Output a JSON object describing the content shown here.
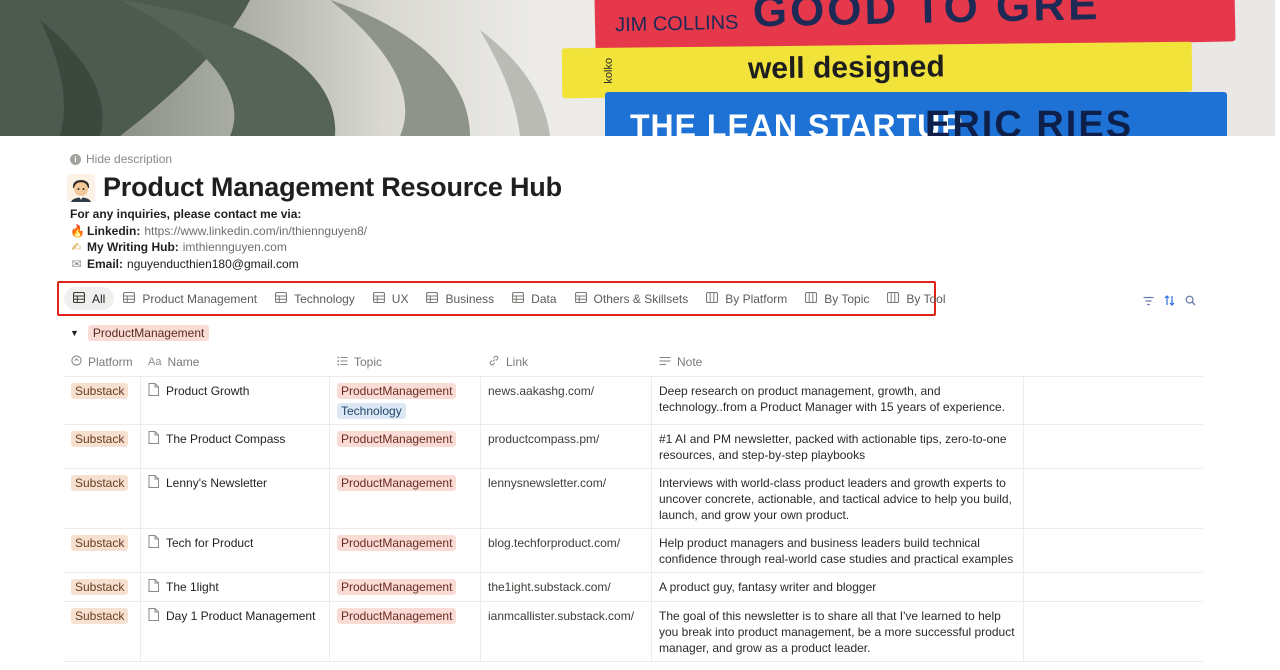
{
  "cover": {
    "books": [
      {
        "author": "JIM COLLINS",
        "title": "GOOD TO GRE",
        "color": "#e8384a"
      },
      {
        "publisher": "kolko",
        "title": "well designed",
        "color": "#f2e23a"
      },
      {
        "title": "THE LEAN STARTUP",
        "author": "ERIC RIES",
        "color": "#1f73d6"
      }
    ]
  },
  "header": {
    "hide_description": "Hide description",
    "title": "Product Management Resource Hub"
  },
  "description": {
    "intro": "For any inquiries, please contact me via:",
    "linkedin_label": "Linkedin:",
    "linkedin_url": "https://www.linkedin.com/in/thiennguyen8/",
    "writing_label": "My Writing Hub:",
    "writing_url": "imthiennguyen.com",
    "email_label": "Email:",
    "email_value": "nguyenducthien180@gmail.com"
  },
  "tabs": [
    {
      "label": "All",
      "icon": "table-icon",
      "active": true
    },
    {
      "label": "Product Management",
      "icon": "table-icon"
    },
    {
      "label": "Technology",
      "icon": "table-icon"
    },
    {
      "label": "UX",
      "icon": "table-icon"
    },
    {
      "label": "Business",
      "icon": "table-icon"
    },
    {
      "label": "Data",
      "icon": "table-icon"
    },
    {
      "label": "Others & Skillsets",
      "icon": "table-icon"
    },
    {
      "label": "By Platform",
      "icon": "board-icon"
    },
    {
      "label": "By Topic",
      "icon": "board-icon"
    },
    {
      "label": "By Tool",
      "icon": "board-icon"
    }
  ],
  "group": {
    "label": "ProductManagement"
  },
  "columns": {
    "platform": "Platform",
    "name": "Name",
    "topic": "Topic",
    "link": "Link",
    "note": "Note"
  },
  "rows": [
    {
      "platform": "Substack",
      "name": "Product Growth",
      "topics": [
        "ProductManagement",
        "Technology"
      ],
      "link": "news.aakashg.com/",
      "note": "Deep research on product management, growth, and technology..from a Product Manager with 15 years of experience."
    },
    {
      "platform": "Substack",
      "name": "The Product Compass",
      "topics": [
        "ProductManagement"
      ],
      "link": "productcompass.pm/",
      "note": "#1 AI and PM newsletter, packed with actionable tips, zero-to-one resources, and step-by-step playbooks"
    },
    {
      "platform": "Substack",
      "name": "Lenny's Newsletter",
      "topics": [
        "ProductManagement"
      ],
      "link": "lennysnewsletter.com/",
      "note": "Interviews with world-class product leaders and growth experts to uncover concrete, actionable, and tactical advice to help you build, launch, and grow your own product."
    },
    {
      "platform": "Substack",
      "name": "Tech for Product",
      "topics": [
        "ProductManagement"
      ],
      "link": "blog.techforproduct.com/",
      "note": "Help product managers and business leaders build technical confidence through real-world case studies and practical examples"
    },
    {
      "platform": "Substack",
      "name": "The 1light",
      "topics": [
        "ProductManagement"
      ],
      "link": "the1ight.substack.com/",
      "note": "A product guy, fantasy writer and blogger"
    },
    {
      "platform": "Substack",
      "name": "Day 1 Product Management",
      "topics": [
        "ProductManagement"
      ],
      "link": "ianmcallister.substack.com/",
      "note": "The goal of this newsletter is to share all that I've learned to help you break into product management, be a more successful product manager, and grow as a product leader."
    }
  ]
}
